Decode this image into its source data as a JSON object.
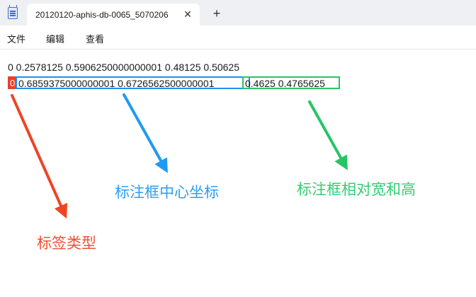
{
  "window": {
    "tab_title": "20120120-aphis-db-0065_5070206",
    "close_glyph": "✕",
    "new_tab_glyph": "+"
  },
  "menu": [
    "文件",
    "编辑",
    "查看"
  ],
  "editor": {
    "line1": "0 0.2578125 0.5906250000000001 0.48125 0.50625",
    "line2": {
      "label": "0",
      "center": "0.6859375000000001 0.6726562500000001",
      "size": "0.4625 0.4765625"
    }
  },
  "annotations": {
    "label_type": "标签类型",
    "box_center": "标注框中心坐标",
    "box_size": "标注框相对宽和高"
  },
  "colors": {
    "red": "#ee4426",
    "blue": "#1f9af2",
    "green": "#27c467"
  }
}
